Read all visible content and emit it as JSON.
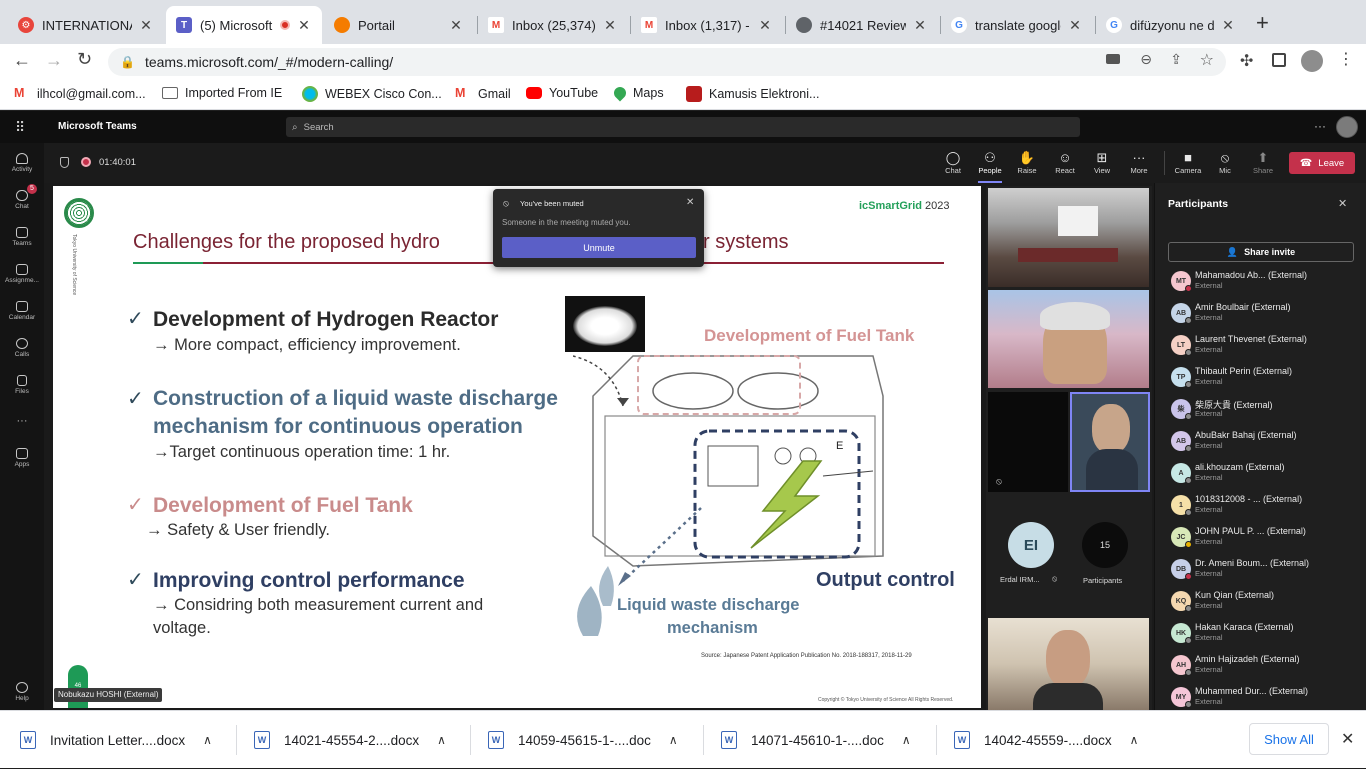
{
  "browser": {
    "tabs": [
      {
        "title": "INTERNATIONAL",
        "color": "#e8453c",
        "glyph": "⚙"
      },
      {
        "title": "(5) Microsoft",
        "color": "#5b5fc7",
        "glyph": "T"
      },
      {
        "title": "Portail",
        "color": "#f57c00",
        "glyph": "●"
      },
      {
        "title": "Inbox (25,374)",
        "color": "#ea4335",
        "glyph": "M"
      },
      {
        "title": "Inbox (1,317) - I",
        "color": "#ea4335",
        "glyph": "M"
      },
      {
        "title": "#14021 Review",
        "color": "#5f6368",
        "glyph": "◍"
      },
      {
        "title": "translate google",
        "color": "#4285f4",
        "glyph": "G"
      },
      {
        "title": "difüzyonu ne de",
        "color": "#4285f4",
        "glyph": "G"
      }
    ],
    "new_tab": "+",
    "url": "teams.microsoft.com/_#/modern-calling/",
    "bookmarks": [
      {
        "label": "ilhcol@gmail.com...",
        "icon": "gmail-icon"
      },
      {
        "label": "Imported From IE",
        "icon": "folder-icon"
      },
      {
        "label": "WEBEX Cisco Con...",
        "icon": "webex-icon"
      },
      {
        "label": "Gmail",
        "icon": "gmail-icon"
      },
      {
        "label": "YouTube",
        "icon": "youtube-icon"
      },
      {
        "label": "Maps",
        "icon": "maps-icon"
      },
      {
        "label": "Kamusis Elektroni...",
        "icon": "kamusis-icon"
      }
    ]
  },
  "teams": {
    "app_name": "Microsoft Teams",
    "search_placeholder": "Search",
    "more": "···",
    "rail": [
      {
        "label": "Activity",
        "badge": ""
      },
      {
        "label": "Chat",
        "badge": "5"
      },
      {
        "label": "Teams",
        "badge": ""
      },
      {
        "label": "Assignme...",
        "badge": ""
      },
      {
        "label": "Calendar",
        "badge": ""
      },
      {
        "label": "Calls",
        "badge": ""
      },
      {
        "label": "Files",
        "badge": ""
      },
      {
        "label": "···",
        "badge": ""
      },
      {
        "label": "Apps",
        "badge": ""
      },
      {
        "label": "Help",
        "badge": ""
      }
    ],
    "timer": "01:40:01",
    "controls": [
      {
        "label": "Chat",
        "glyph": "💬"
      },
      {
        "label": "People",
        "glyph": "👥"
      },
      {
        "label": "Raise",
        "glyph": "✋"
      },
      {
        "label": "React",
        "glyph": "☺"
      },
      {
        "label": "View",
        "glyph": "⊞"
      },
      {
        "label": "More",
        "glyph": "···"
      },
      {
        "label": "Camera",
        "glyph": "■"
      },
      {
        "label": "Mic",
        "glyph": "🎙"
      },
      {
        "label": "Share",
        "glyph": "⬆"
      }
    ],
    "leave": "Leave"
  },
  "toast": {
    "title": "You've been muted",
    "body": "Someone in the meeting muted you.",
    "button": "Unmute"
  },
  "slide": {
    "brand_a": "icSmartGrid",
    "brand_b": " 2023",
    "university_vertical": "Tokyo University of Science",
    "title": "Challenges for the proposed hydro",
    "title_tail": "r systems",
    "items": [
      {
        "head": "Development of Hydrogen Reactor",
        "sub": "→ More compact, efficiency improvement."
      },
      {
        "head": "Construction of a liquid waste discharge",
        "head2": "mechanism for continuous operation",
        "sub": "→Target continuous operation time: 1 hr."
      },
      {
        "head": "Development of Fuel Tank",
        "sub": "→ Safety & User friendly."
      },
      {
        "head": "Improving control performance",
        "sub": "→ Considring both measurement current and",
        "sub2": "voltage."
      }
    ],
    "fig_fuel_tank": "Development of Fuel Tank",
    "fig_output": "Output control",
    "fig_liquid_1": "Liquid waste discharge",
    "fig_liquid_2": "mechanism",
    "fig_e": "E",
    "source": "Source: Japanese Patent Application Publication No. 2018-188317,   2018-11-29",
    "copyright": "Copyright © Tokyo University of Science All Rights Reserved.",
    "slide_num": "46",
    "presenter": "Nobukazu HOSHI (External)"
  },
  "videos": {
    "tile_ei_initials": "EI",
    "tile_ei_name": "Erdal IRM...",
    "participants_count": "15",
    "participants_label": "Participants"
  },
  "panel": {
    "title": "Participants",
    "share": "Share invite",
    "people": [
      {
        "initials": "MT",
        "name": "Mahamadou Ab... (External)",
        "color": "#f5c6cf",
        "dot": "#c4314b"
      },
      {
        "initials": "AB",
        "name": "Amir Boulbair (External)",
        "color": "#c5d5e8",
        "dot": "#8a8a8a"
      },
      {
        "initials": "LT",
        "name": "Laurent Thevenet (External)",
        "color": "#f5d0c5",
        "dot": "#8a8a8a"
      },
      {
        "initials": "TP",
        "name": "Thibault Perin (External)",
        "color": "#c6e0ee",
        "dot": "#8a8a8a"
      },
      {
        "initials": "柴",
        "name": "柴原大貴 (External)",
        "color": "#c9c3ea",
        "dot": "#8a8a8a"
      },
      {
        "initials": "AB",
        "name": "AbuBakr Bahaj (External)",
        "color": "#d3c6ea",
        "dot": "#8a8a8a"
      },
      {
        "initials": "A",
        "name": "ali.khouzam (External)",
        "color": "#c6e8e5",
        "dot": "#8a8a8a"
      },
      {
        "initials": "1",
        "name": "1018312008 - ...    (External)",
        "color": "#f6e0a8",
        "dot": "#8a8a8a"
      },
      {
        "initials": "JC",
        "name": "JOHN PAUL P. ...   (External)",
        "color": "#d8e8b8",
        "dot": "#e8b200"
      },
      {
        "initials": "DB",
        "name": "Dr. Ameni Boum... (External)",
        "color": "#c6cfe8",
        "dot": "#c4314b"
      },
      {
        "initials": "KQ",
        "name": "Kun Qian (External)",
        "color": "#f5d8b0",
        "dot": "#8a8a8a"
      },
      {
        "initials": "HK",
        "name": "Hakan Karaca (External)",
        "color": "#c6e8d2",
        "dot": "#8a8a8a"
      },
      {
        "initials": "AH",
        "name": "Amin Hajizadeh (External)",
        "color": "#f5c6cf",
        "dot": "#8a8a8a"
      },
      {
        "initials": "MY",
        "name": "Muhammed Dur... (External)",
        "color": "#f5c6d8",
        "dot": "#8a8a8a"
      }
    ],
    "external": "External"
  },
  "downloads": {
    "files": [
      "Invitation Letter....docx",
      "14021-45554-2....docx",
      "14059-45615-1-....doc",
      "14071-45610-1-....doc",
      "14042-45559-....docx"
    ],
    "show_all": "Show All"
  }
}
